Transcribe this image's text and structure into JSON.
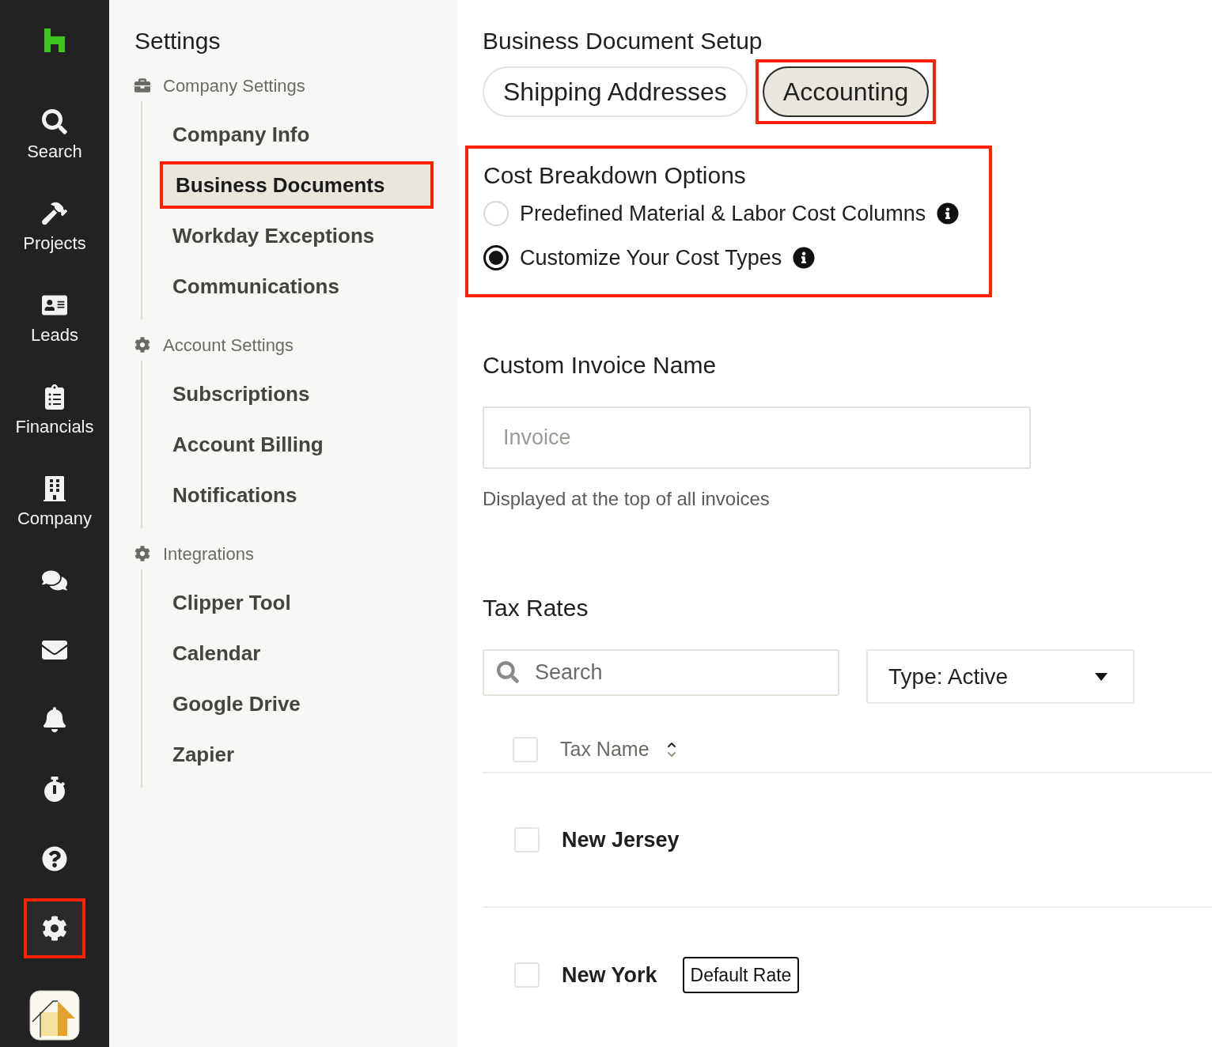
{
  "rail": {
    "items": [
      {
        "kind": "search",
        "label": "Search",
        "highlighted": false
      },
      {
        "kind": "projects",
        "label": "Projects",
        "highlighted": false
      },
      {
        "kind": "leads",
        "label": "Leads",
        "highlighted": false
      },
      {
        "kind": "financials",
        "label": "Financials",
        "highlighted": false
      },
      {
        "kind": "company",
        "label": "Company",
        "highlighted": false
      },
      {
        "kind": "messages",
        "highlighted": false
      },
      {
        "kind": "mail",
        "highlighted": false
      },
      {
        "kind": "bell",
        "highlighted": false
      },
      {
        "kind": "timer",
        "highlighted": false
      },
      {
        "kind": "help",
        "highlighted": false
      },
      {
        "kind": "settings",
        "highlighted": true
      },
      {
        "kind": "app",
        "highlighted": false
      }
    ]
  },
  "sidebar": {
    "title": "Settings",
    "groups": [
      {
        "kind": "briefcase",
        "heading": "Company Settings",
        "items": [
          {
            "label": "Company Info",
            "selected": false,
            "highlighted": false
          },
          {
            "label": "Business Documents",
            "selected": true,
            "highlighted": true
          },
          {
            "label": "Workday Exceptions",
            "selected": false,
            "highlighted": false
          },
          {
            "label": "Communications",
            "selected": false,
            "highlighted": false
          }
        ]
      },
      {
        "kind": "gear",
        "heading": "Account Settings",
        "items": [
          {
            "label": "Subscriptions",
            "selected": false,
            "highlighted": false
          },
          {
            "label": "Account Billing",
            "selected": false,
            "highlighted": false
          },
          {
            "label": "Notifications",
            "selected": false,
            "highlighted": false
          }
        ]
      },
      {
        "kind": "gear",
        "heading": "Integrations",
        "items": [
          {
            "label": "Clipper Tool",
            "selected": false,
            "highlighted": false
          },
          {
            "label": "Calendar",
            "selected": false,
            "highlighted": false
          },
          {
            "label": "Google Drive",
            "selected": false,
            "highlighted": false
          },
          {
            "label": "Zapier",
            "selected": false,
            "highlighted": false
          }
        ]
      }
    ]
  },
  "main": {
    "title": "Business Document Setup",
    "tabs": [
      {
        "label": "Shipping Addresses",
        "selected": false,
        "highlighted": false
      },
      {
        "label": "Accounting",
        "selected": true,
        "highlighted": true
      }
    ],
    "cost_breakdown": {
      "title": "Cost Breakdown Options",
      "highlighted": true,
      "options": [
        {
          "label": "Predefined Material & Labor Cost Columns",
          "selected": false
        },
        {
          "label": "Customize Your Cost Types",
          "selected": true
        }
      ]
    },
    "invoice_name": {
      "title": "Custom Invoice Name",
      "placeholder": "Invoice",
      "help": "Displayed at the top of all invoices"
    },
    "tax_rates": {
      "title": "Tax Rates",
      "search_placeholder": "Search",
      "filter": "Type: Active",
      "select_all_checked": false,
      "columns": [
        "Tax Name"
      ],
      "rows": [
        {
          "name": "New Jersey",
          "checked": false
        },
        {
          "name": "New York",
          "checked": false,
          "badge": "Default Rate"
        }
      ]
    }
  }
}
